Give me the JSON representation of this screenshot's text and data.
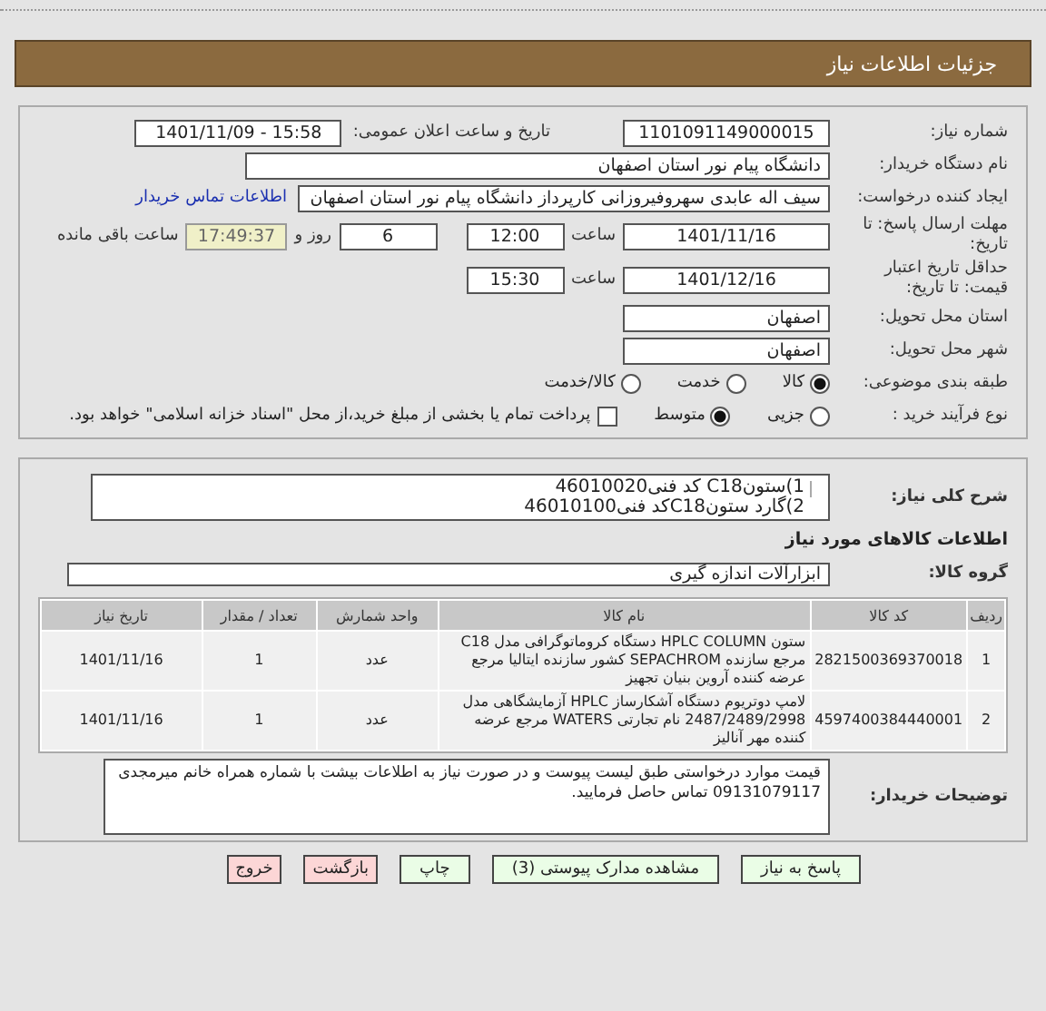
{
  "header": {
    "title": "جزئیات اطلاعات نیاز"
  },
  "need_number": {
    "label": "شماره نیاز:",
    "value": "1101091149000015"
  },
  "announce": {
    "label": "تاریخ و ساعت اعلان عمومی:",
    "value": "1401/11/09 - 15:58"
  },
  "buyer": {
    "label": "نام دستگاه خریدار:",
    "value": "دانشگاه پیام نور استان اصفهان"
  },
  "requester": {
    "label": "ایجاد کننده درخواست:",
    "value": "سیف اله عابدی سهروفیروزانی کارپرداز دانشگاه پیام نور استان اصفهان",
    "link": "اطلاعات تماس خریدار"
  },
  "deadline": {
    "label": "مهلت ارسال پاسخ: تا تاریخ:",
    "date": "1401/11/16",
    "time_label": "ساعت",
    "time": "12:00",
    "days": "6",
    "days_label": "روز و",
    "remaining": "17:49:37",
    "remaining_label": "ساعت باقی مانده"
  },
  "validity": {
    "label": "حداقل تاریخ اعتبار قیمت: تا تاریخ:",
    "date": "1401/12/16",
    "time_label": "ساعت",
    "time": "15:30"
  },
  "province": {
    "label": "استان محل تحویل:",
    "value": "اصفهان"
  },
  "city": {
    "label": "شهر محل تحویل:",
    "value": "اصفهان"
  },
  "category": {
    "label": "طبقه بندی موضوعی:",
    "options": [
      {
        "label": "کالا",
        "selected": true
      },
      {
        "label": "خدمت",
        "selected": false
      },
      {
        "label": "کالا/خدمت",
        "selected": false
      }
    ]
  },
  "process": {
    "label": "نوع فرآیند خرید :",
    "options": [
      {
        "label": "جزیی",
        "selected": false
      },
      {
        "label": "متوسط",
        "selected": true
      }
    ],
    "treasury": {
      "label": "پرداخت تمام یا بخشی از مبلغ خرید،از محل \"اسناد خزانه اسلامی\" خواهد بود.",
      "checked": false
    }
  },
  "description": {
    "label": "شرح کلی نیاز:",
    "lines": [
      "1)ستونC18 کد فنی46010020",
      "2)گارد ستونC18کد فنی46010100"
    ]
  },
  "goods_heading": "اطلاعات کالاهای مورد نیاز",
  "group": {
    "label": "گروه کالا:",
    "value": "ابزارآلات اندازه گیری"
  },
  "table": {
    "columns": [
      "ردیف",
      "کد کالا",
      "نام کالا",
      "واحد شمارش",
      "تعداد / مقدار",
      "تاریخ نیاز"
    ],
    "rows": [
      [
        "1",
        "2821500369370018",
        "ستون HPLC COLUMN دستگاه کروماتوگرافی مدل C18 مرجع سازنده SEPACHROM کشور سازنده ایتالیا مرجع عرضه کننده آروین بنیان تجهیز",
        "عدد",
        "1",
        "1401/11/16"
      ],
      [
        "2",
        "4597400384440001",
        "لامپ دوتریوم دستگاه آشکارساز HPLC آزمایشگاهی مدل 2487/2489/2998 نام تجارتی WATERS مرجع عرضه کننده مهر آنالیز",
        "عدد",
        "1",
        "1401/11/16"
      ]
    ]
  },
  "notes": {
    "label": "توضیحات خریدار:",
    "text": "قیمت موارد درخواستی طبق لیست پیوست و در صورت نیاز به اطلاعات بیشت با شماره همراه خانم میرمجدی 09131079117 تماس حاصل فرمایید."
  },
  "buttons": [
    {
      "label": "پاسخ به نیاز",
      "kind": "primary"
    },
    {
      "label": "مشاهده مدارک پیوستی (3)",
      "kind": "primary"
    },
    {
      "label": "چاپ",
      "kind": "primary"
    },
    {
      "label": "بازگشت",
      "kind": "danger"
    },
    {
      "label": "خروج",
      "kind": "danger"
    }
  ]
}
